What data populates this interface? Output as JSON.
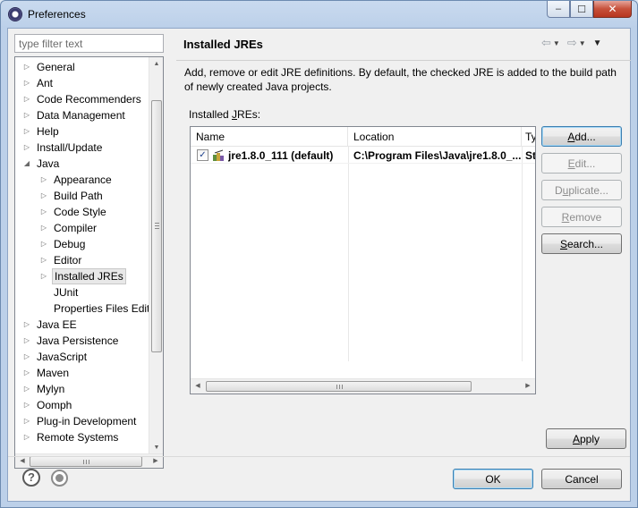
{
  "window": {
    "title": "Preferences",
    "controls": {
      "minimize": "–",
      "maximize": "☐",
      "close": "✕"
    }
  },
  "filter": {
    "placeholder": "type filter text"
  },
  "tree": {
    "items": [
      {
        "label": "General",
        "expander": "▷"
      },
      {
        "label": "Ant",
        "expander": "▷"
      },
      {
        "label": "Code Recommenders",
        "expander": "▷"
      },
      {
        "label": "Data Management",
        "expander": "▷"
      },
      {
        "label": "Help",
        "expander": "▷"
      },
      {
        "label": "Install/Update",
        "expander": "▷"
      },
      {
        "label": "Java",
        "expander": "◢"
      },
      {
        "label": "Appearance",
        "expander": "▷"
      },
      {
        "label": "Build Path",
        "expander": "▷"
      },
      {
        "label": "Code Style",
        "expander": "▷"
      },
      {
        "label": "Compiler",
        "expander": "▷"
      },
      {
        "label": "Debug",
        "expander": "▷"
      },
      {
        "label": "Editor",
        "expander": "▷"
      },
      {
        "label": "Installed JREs",
        "expander": "▷"
      },
      {
        "label": "JUnit",
        "expander": ""
      },
      {
        "label": "Properties Files Editor",
        "expander": ""
      },
      {
        "label": "Java EE",
        "expander": "▷"
      },
      {
        "label": "Java Persistence",
        "expander": "▷"
      },
      {
        "label": "JavaScript",
        "expander": "▷"
      },
      {
        "label": "Maven",
        "expander": "▷"
      },
      {
        "label": "Mylyn",
        "expander": "▷"
      },
      {
        "label": "Oomph",
        "expander": "▷"
      },
      {
        "label": "Plug-in Development",
        "expander": "▷"
      },
      {
        "label": "Remote Systems",
        "expander": "▷"
      }
    ],
    "scroll_arrows": {
      "up": "▲",
      "down": "▼",
      "left": "◀",
      "right": "▶"
    }
  },
  "page": {
    "title": "Installed JREs",
    "nav": {
      "back": "⇦",
      "forward": "⇨",
      "dropdown": "▼",
      "menu": "▼"
    },
    "description": "Add, remove or edit JRE definitions. By default, the checked JRE is added to the build path of newly created Java projects.",
    "list_label_prefix": "Installed ",
    "list_label_mnemonic": "J",
    "list_label_suffix": "REs:"
  },
  "table": {
    "columns": [
      "Name",
      "Location",
      "Ty"
    ],
    "rows": [
      {
        "checked": true,
        "check_glyph": "✓",
        "name": "jre1.8.0_111 (default)",
        "location": "C:\\Program Files\\Java\\jre1.8.0_...",
        "type": "St"
      }
    ]
  },
  "buttons": {
    "add": {
      "pre": "",
      "mn": "A",
      "post": "dd..."
    },
    "edit": {
      "pre": "",
      "mn": "E",
      "post": "dit..."
    },
    "duplicate": {
      "pre": "D",
      "mn": "u",
      "post": "plicate..."
    },
    "remove": {
      "pre": "",
      "mn": "R",
      "post": "emove"
    },
    "search": {
      "pre": "",
      "mn": "S",
      "post": "earch..."
    },
    "apply": {
      "pre": "",
      "mn": "A",
      "post": "pply"
    },
    "ok": "OK",
    "cancel": "Cancel"
  },
  "footer": {
    "help_glyph": "?"
  }
}
